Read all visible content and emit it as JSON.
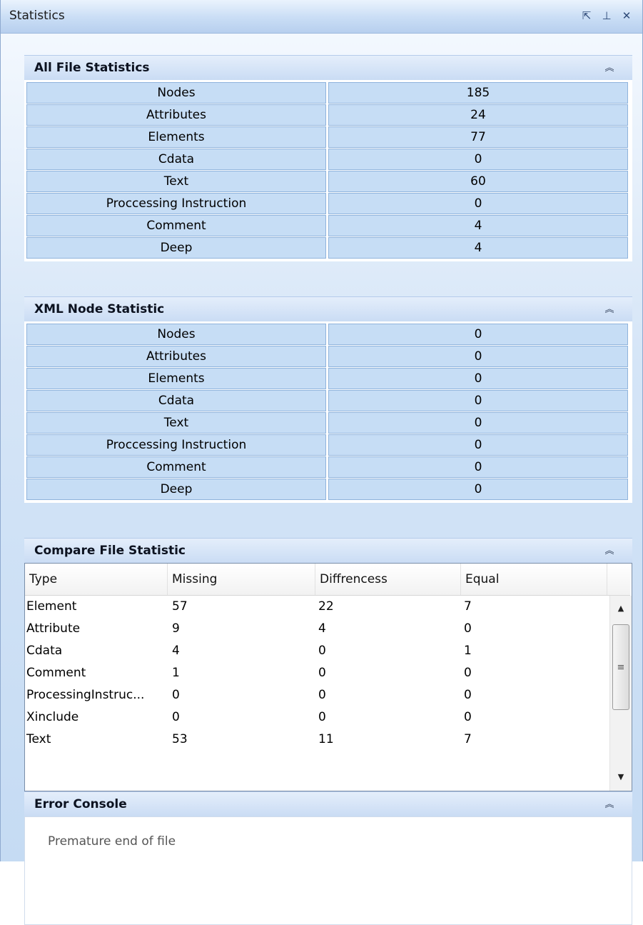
{
  "window": {
    "title": "Statistics",
    "buttons": {
      "float": "⇱",
      "pin": "⊥",
      "close": "✕"
    }
  },
  "collapse_glyph": "︽",
  "all_file": {
    "title": "All File Statistics",
    "rows": [
      {
        "label": "Nodes",
        "value": "185"
      },
      {
        "label": "Attributes",
        "value": "24"
      },
      {
        "label": "Elements",
        "value": "77"
      },
      {
        "label": "Cdata",
        "value": "0"
      },
      {
        "label": "Text",
        "value": "60"
      },
      {
        "label": "Proccessing Instruction",
        "value": "0"
      },
      {
        "label": "Comment",
        "value": "4"
      },
      {
        "label": "Deep",
        "value": "4"
      }
    ]
  },
  "xml_node": {
    "title": "XML Node Statistic",
    "rows": [
      {
        "label": "Nodes",
        "value": "0"
      },
      {
        "label": "Attributes",
        "value": "0"
      },
      {
        "label": "Elements",
        "value": "0"
      },
      {
        "label": "Cdata",
        "value": "0"
      },
      {
        "label": "Text",
        "value": "0"
      },
      {
        "label": "Proccessing Instruction",
        "value": "0"
      },
      {
        "label": "Comment",
        "value": "0"
      },
      {
        "label": "Deep",
        "value": "0"
      }
    ]
  },
  "compare": {
    "title": "Compare File Statistic",
    "columns": [
      "Type",
      "Missing",
      "Diffrencess",
      "Equal"
    ],
    "rows": [
      [
        "Element",
        "57",
        "22",
        "7"
      ],
      [
        "Attribute",
        "9",
        "4",
        "0"
      ],
      [
        "Cdata",
        "4",
        "0",
        "1"
      ],
      [
        "Comment",
        "1",
        "0",
        "0"
      ],
      [
        "ProcessingInstruc...",
        "0",
        "0",
        "0"
      ],
      [
        "Xinclude",
        "0",
        "0",
        "0"
      ],
      [
        "Text",
        "53",
        "11",
        "7"
      ]
    ],
    "scroll": {
      "up": "▲",
      "down": "▼",
      "grip": "≡"
    }
  },
  "error_console": {
    "title": "Error Console",
    "message": "Premature end of file"
  }
}
